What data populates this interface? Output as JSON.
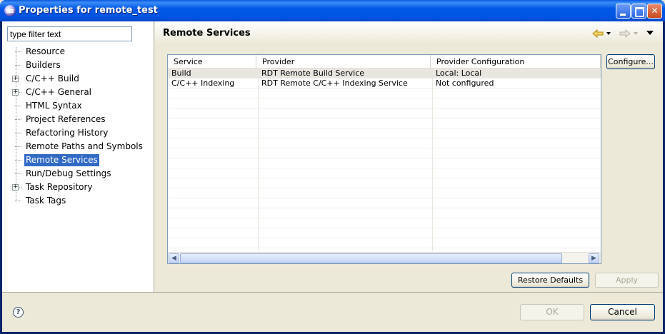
{
  "window": {
    "title": "Properties for remote_test"
  },
  "filter": {
    "placeholder": "type filter text"
  },
  "tree": {
    "items": [
      {
        "label": "Resource",
        "expandable": false
      },
      {
        "label": "Builders",
        "expandable": false
      },
      {
        "label": "C/C++ Build",
        "expandable": true
      },
      {
        "label": "C/C++ General",
        "expandable": true
      },
      {
        "label": "HTML Syntax",
        "expandable": false
      },
      {
        "label": "Project References",
        "expandable": false
      },
      {
        "label": "Refactoring History",
        "expandable": false
      },
      {
        "label": "Remote Paths and Symbols",
        "expandable": false
      },
      {
        "label": "Remote Services",
        "expandable": false,
        "selected": true
      },
      {
        "label": "Run/Debug Settings",
        "expandable": false
      },
      {
        "label": "Task Repository",
        "expandable": true
      },
      {
        "label": "Task Tags",
        "expandable": false
      }
    ]
  },
  "page": {
    "title": "Remote Services"
  },
  "table": {
    "columns": [
      "Service",
      "Provider",
      "Provider Configuration"
    ],
    "rows": [
      {
        "service": "Build",
        "provider": "RDT Remote Build Service",
        "config": "Local: Local"
      },
      {
        "service": "C/C++ Indexing",
        "provider": "RDT Remote C/C++ Indexing Service",
        "config": "Not configured"
      }
    ]
  },
  "buttons": {
    "configure": "Configure...",
    "restore_defaults": "Restore Defaults",
    "apply": "Apply",
    "ok": "OK",
    "cancel": "Cancel"
  },
  "colors": {
    "selection": "#316ac5",
    "titlebar": "#0054e3"
  }
}
